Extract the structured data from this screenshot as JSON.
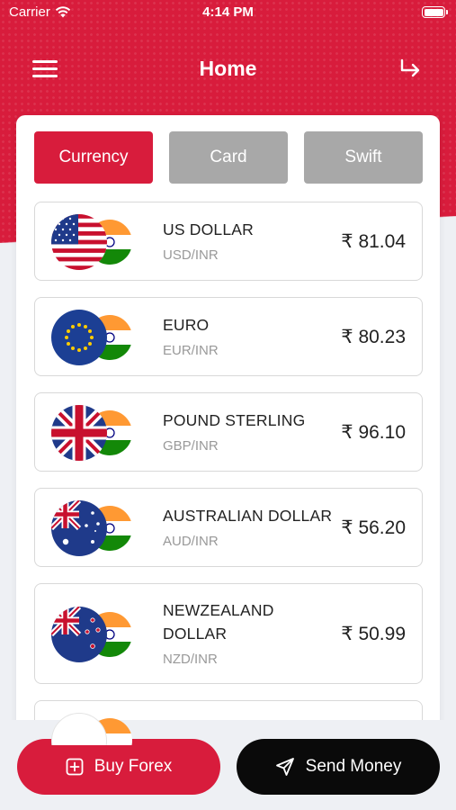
{
  "status": {
    "carrier": "Carrier",
    "time": "4:14 PM"
  },
  "nav": {
    "title": "Home"
  },
  "tabs": [
    "Currency",
    "Card",
    "Swift"
  ],
  "currencies": [
    {
      "name": "US DOLLAR",
      "pair": "USD/INR",
      "rate": "₹ 81.04",
      "flag": "us-flag-icon"
    },
    {
      "name": "EURO",
      "pair": "EUR/INR",
      "rate": "₹ 80.23",
      "flag": "eu-flag-icon"
    },
    {
      "name": "POUND STERLING",
      "pair": "GBP/INR",
      "rate": "₹ 96.10",
      "flag": "uk-flag-icon"
    },
    {
      "name": "AUSTRALIAN DOLLAR",
      "pair": "AUD/INR",
      "rate": "₹ 56.20",
      "flag": "au-flag-icon"
    },
    {
      "name_line1": "NEWZEALAND",
      "name_line2": "DOLLAR",
      "pair": "NZD/INR",
      "rate": "₹ 50.99",
      "flag": "nz-flag-icon"
    }
  ],
  "actions": {
    "buy": "Buy Forex",
    "send": "Send Money"
  },
  "colors": {
    "brand": "#d81c3c",
    "tab_inactive": "#a8a8a8",
    "send_bg": "#0a0a0a"
  }
}
